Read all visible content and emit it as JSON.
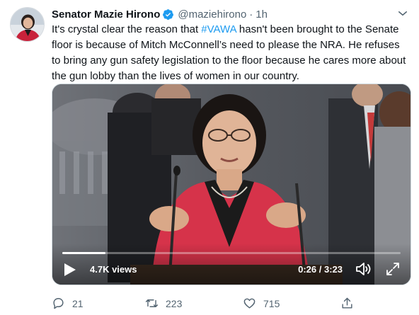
{
  "tweet": {
    "author_name": "Senator Mazie Hirono",
    "handle": "@maziehirono",
    "separator": "·",
    "time": "1h",
    "text_before": "It's crystal clear the reason that ",
    "hashtag": "#VAWA",
    "text_after": " hasn't been brought to the Senate floor is because of Mitch McConnell’s need to please the NRA. He refuses to bring any gun safety legislation to the floor because he cares more about the gun lobby than the lives of women in our country."
  },
  "video": {
    "views": "4.7K views",
    "time_readout": "0:26 / 3:23",
    "progress_fraction": 0.128
  },
  "actions": {
    "reply_count": "21",
    "retweet_count": "223",
    "like_count": "715"
  },
  "icons": {
    "verified": "verified-badge-icon",
    "caret": "chevron-down-icon",
    "play": "play-icon",
    "volume": "volume-icon",
    "fullscreen": "fullscreen-icon",
    "reply": "reply-icon",
    "retweet": "retweet-icon",
    "like": "heart-icon",
    "share": "share-icon"
  },
  "colors": {
    "link": "#1d9bf0",
    "verified": "#1d9bf0",
    "muted": "#536471",
    "jacket": "#d6334a"
  }
}
